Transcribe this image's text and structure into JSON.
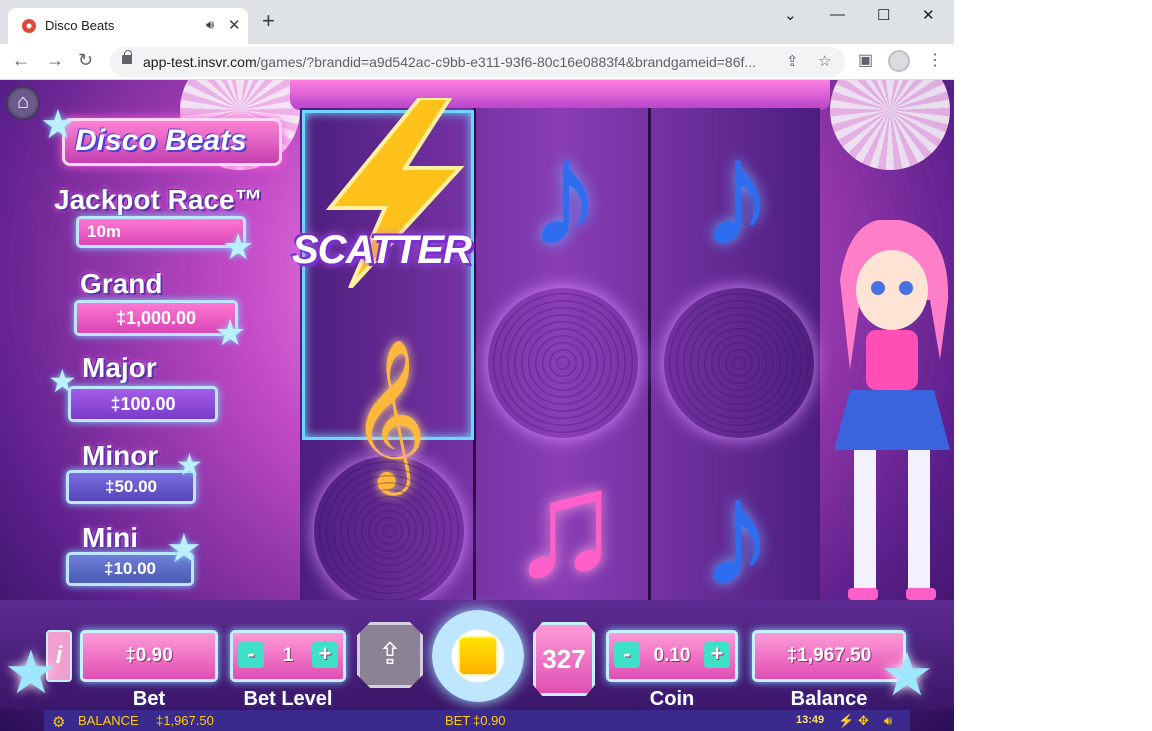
{
  "browser": {
    "tab_title": "Disco Beats",
    "url_host": "app-test.insvr.com",
    "url_path": "/games/?brandid=a9d542ac-c9bb-e311-93f6-80c16e0883f4&brandgameid=86f..."
  },
  "game": {
    "logo": "Disco Beats",
    "scatter_label": "SCATTER",
    "jackpots": {
      "race_title": "Jackpot Race™",
      "race_value": "10m",
      "grand_title": "Grand",
      "grand_value": "‡1,000.00",
      "major_title": "Major",
      "major_value": "‡100.00",
      "minor_title": "Minor",
      "minor_value": "‡50.00",
      "mini_title": "Mini",
      "mini_value": "‡10.00"
    },
    "controls": {
      "info_label": "i",
      "bet_value": "‡0.90",
      "bet_label": "Bet",
      "bet_level_value": "1",
      "bet_level_label": "Bet Level",
      "minus": "-",
      "plus": "+",
      "spins_count": "327",
      "coin_value": "0.10",
      "coin_label": "Coin",
      "balance_value": "‡1,967.50",
      "balance_label": "Balance"
    },
    "statusbar": {
      "balance_label": "BALANCE",
      "balance_value": "‡1,967.50",
      "bet_label": "BET",
      "bet_value": "‡0.90",
      "time": "13:49"
    }
  },
  "colors": {
    "accent": "#ff5fc8",
    "frame": "#c6f0ff",
    "status_text": "#ffcc00"
  }
}
